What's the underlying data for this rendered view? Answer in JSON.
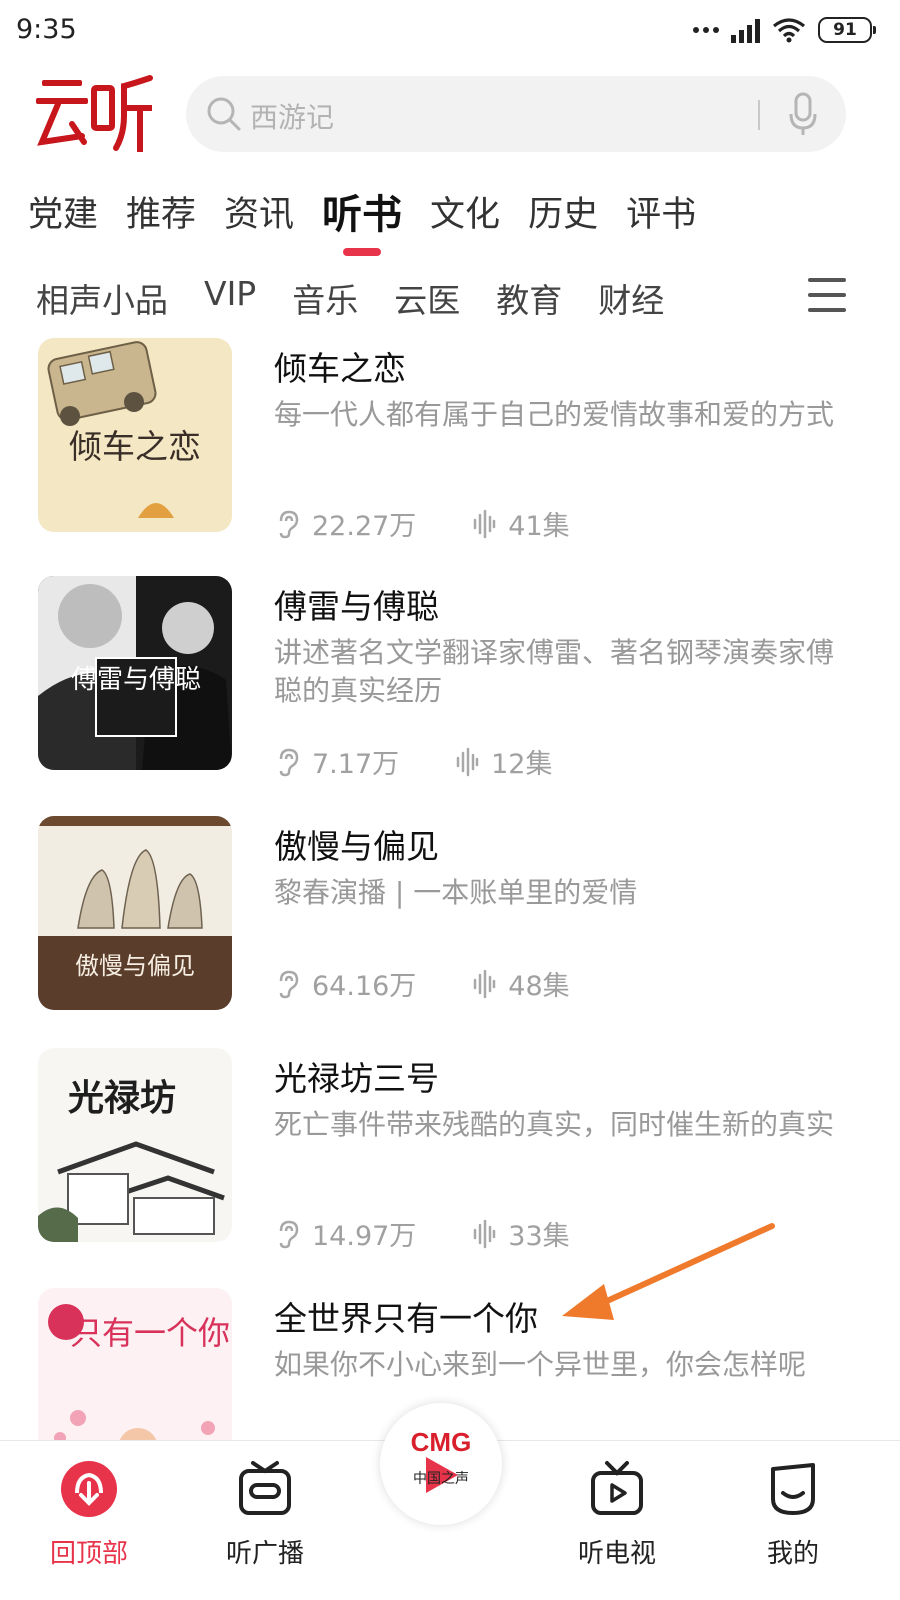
{
  "status_bar": {
    "time": "9:35",
    "battery": "91"
  },
  "header": {
    "logo_text": "云听",
    "search_placeholder": "西游记"
  },
  "tabs": [
    "党建",
    "推荐",
    "资讯",
    "听书",
    "文化",
    "历史",
    "评书"
  ],
  "active_tab": "听书",
  "subtabs": [
    "相声小品",
    "VIP",
    "音乐",
    "云医",
    "教育",
    "财经"
  ],
  "books": [
    {
      "title": "倾车之恋",
      "desc": "每一代人都有属于自己的爱情故事和爱的方式",
      "plays": "22.27万",
      "episodes": "41集",
      "cover_text": "倾车之恋"
    },
    {
      "title": "傅雷与傅聪",
      "desc": "讲述著名文学翻译家傅雷、著名钢琴演奏家傅聪的真实经历",
      "plays": "7.17万",
      "episodes": "12集",
      "cover_text": "傅雷与傅聪"
    },
    {
      "title": "傲慢与偏见",
      "desc": "黎春演播 | 一本账单里的爱情",
      "plays": "64.16万",
      "episodes": "48集",
      "cover_text": "傲慢与偏见"
    },
    {
      "title": "光禄坊三号",
      "desc": "死亡事件带来残酷的真实，同时催生新的真实",
      "plays": "14.97万",
      "episodes": "33集",
      "cover_text": "光禄坊"
    },
    {
      "title": "全世界只有一个你",
      "desc": "如果你不小心来到一个异世里，你会怎样呢",
      "plays": "",
      "episodes": "",
      "cover_text": "只有一个你"
    }
  ],
  "bottom_nav": [
    {
      "label": "回顶部",
      "icon": "back-to-top-icon",
      "active": true
    },
    {
      "label": "听广播",
      "icon": "radio-icon",
      "active": false
    },
    {
      "label": "中国之声",
      "icon": "cmg-play-icon",
      "active": false
    },
    {
      "label": "听电视",
      "icon": "tv-icon",
      "active": false
    },
    {
      "label": "我的",
      "icon": "profile-icon",
      "active": false
    }
  ],
  "center_button": {
    "brand": "CMG",
    "sub": "中国之声"
  },
  "colors": {
    "accent": "#e8344a",
    "text": "#222222",
    "muted": "#999999",
    "annotation_arrow": "#f07a2c"
  }
}
